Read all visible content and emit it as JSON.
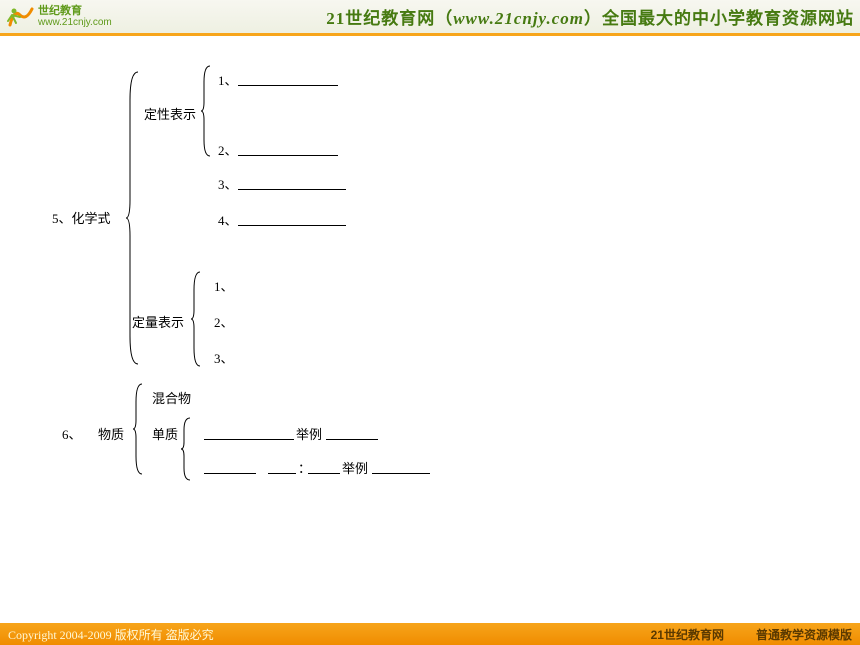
{
  "header": {
    "logo_upper": "世纪教育",
    "logo_url": "www.21cnjy.com",
    "title_prefix": "21世纪教育网（",
    "title_url": "www.21cnjy.com",
    "title_suffix": "）全国最大的中小学教育资源网站"
  },
  "section5": {
    "label": "5、化学式",
    "qualitative_label": "定性表示",
    "q1": "1、",
    "q2": "2、",
    "q3": "3、",
    "q4": "4、",
    "quantitative_label": "定量表示",
    "qq1": "1、",
    "qq2": "2、",
    "qq3": "3、"
  },
  "section6": {
    "label": "6、",
    "subject": "物质",
    "mixture": "混合物",
    "pure_simple": "单质",
    "example_label_a": "举例",
    "sep": "：",
    "example_label_b": "举例"
  },
  "footer": {
    "copyright": "Copyright 2004-2009 版权所有 盗版必究",
    "site": "21世纪教育网",
    "template": "普通教学资源模版"
  }
}
